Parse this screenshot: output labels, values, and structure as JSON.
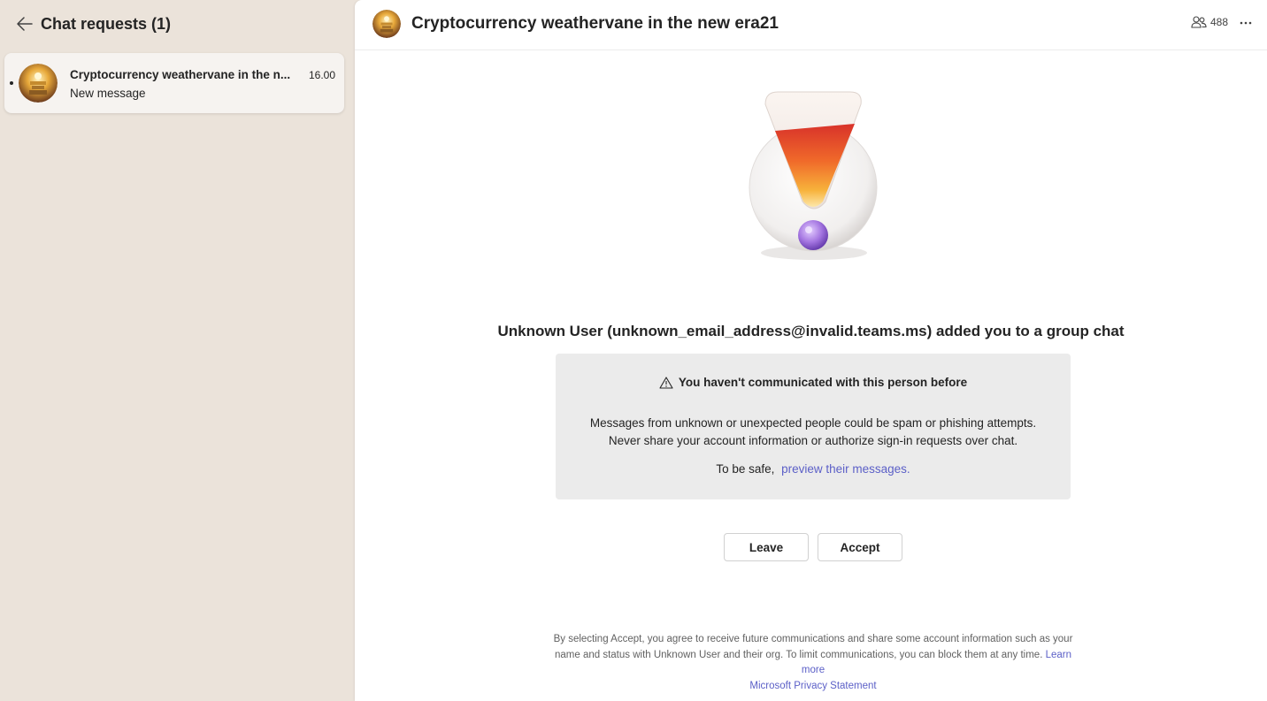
{
  "sidebar": {
    "title": "Chat requests (1)",
    "requests": [
      {
        "name": "Cryptocurrency weathervane in the n...",
        "time": "16.00",
        "preview": "New message"
      }
    ]
  },
  "chat": {
    "title": "Cryptocurrency weathervane in the new era21",
    "participant_count": "488"
  },
  "notice": {
    "headline": "Unknown User (unknown_email_address@invalid.teams.ms) added you to a group chat",
    "warning_title": "You haven't communicated with this person before",
    "body_line1": "Messages from unknown or unexpected people could be spam or phishing attempts.",
    "body_line2": "Never share your account information or authorize sign-in requests over chat.",
    "safe_prefix": "To be safe,",
    "safe_link": "preview their messages."
  },
  "actions": {
    "leave_label": "Leave",
    "accept_label": "Accept"
  },
  "footer": {
    "text": "By selecting Accept, you agree to receive future communications and share some account information such as your name and status with Unknown User and their org. To limit communications, you can block them at any time.",
    "learn_more": "Learn more",
    "privacy": "Microsoft Privacy Statement"
  },
  "colors": {
    "sidebar_bg": "#ebe3da",
    "link": "#5b5fc7",
    "warning_box": "#ebebeb"
  },
  "icons": [
    "arrow-left-icon",
    "people-icon",
    "more-horizontal-icon",
    "warning-icon",
    "alert-illustration"
  ]
}
